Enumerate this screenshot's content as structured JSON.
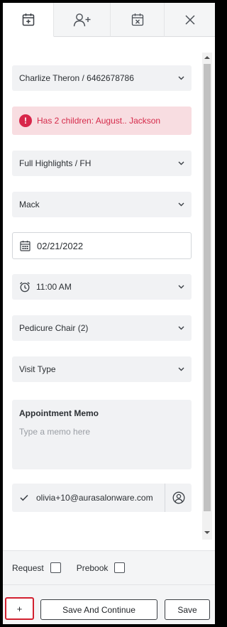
{
  "tabs": [
    {
      "name": "tab-new-appointment",
      "icon": "calendar-plus-icon",
      "active": true
    },
    {
      "name": "tab-add-client",
      "icon": "add-user-icon",
      "active": false
    },
    {
      "name": "tab-cancel-appointment",
      "icon": "calendar-x-icon",
      "active": false
    },
    {
      "name": "tab-close",
      "icon": "close-icon",
      "active": false
    }
  ],
  "form": {
    "client": "Charlize Theron / 6462678786",
    "alert": "Has 2 children: August.. Jackson",
    "service": "Full Highlights / FH",
    "staff": "Mack",
    "date": "02/21/2022",
    "time": "11:00 AM",
    "resource": "Pedicure Chair (2)",
    "visit_type": "Visit Type",
    "memo_title": "Appointment Memo",
    "memo_placeholder": "Type a memo here",
    "email": "olivia+10@aurasalonware.com"
  },
  "options": {
    "request_label": "Request",
    "prebook_label": "Prebook"
  },
  "actions": {
    "add_label": "+",
    "save_continue_label": "Save And Continue",
    "save_label": "Save"
  },
  "colors": {
    "alert_text": "#d52a4a",
    "alert_bg": "#f8dde1",
    "field_bg": "#f1f2f4",
    "highlight_border": "#d2202f"
  }
}
